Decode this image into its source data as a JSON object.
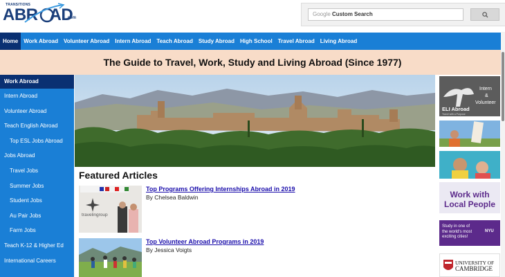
{
  "header": {
    "logo_small": "TRANSITIONS",
    "logo_main": "ABR",
    "logo_main_rest": "AD",
    "logo_com": ".com",
    "search_brand": "Google",
    "search_placeholder": "Custom Search"
  },
  "nav": {
    "items": [
      {
        "label": "Home"
      },
      {
        "label": "Work Abroad"
      },
      {
        "label": "Volunteer Abroad"
      },
      {
        "label": "Intern Abroad"
      },
      {
        "label": "Teach Abroad"
      },
      {
        "label": "Study Abroad"
      },
      {
        "label": "High School"
      },
      {
        "label": "Travel Abroad"
      },
      {
        "label": "Living Abroad"
      }
    ]
  },
  "banner": {
    "title": "The Guide to Travel, Work, Study and Living Abroad (Since 1977)"
  },
  "sidebar": {
    "items": [
      {
        "label": "Work Abroad"
      },
      {
        "label": "Intern Abroad"
      },
      {
        "label": "Volunteer Abroad"
      },
      {
        "label": "Teach English Abroad"
      },
      {
        "label": "Top ESL Jobs Abroad"
      },
      {
        "label": "Jobs Abroad"
      },
      {
        "label": "Travel Jobs"
      },
      {
        "label": "Summer Jobs"
      },
      {
        "label": "Student Jobs"
      },
      {
        "label": "Au Pair Jobs"
      },
      {
        "label": "Farm Jobs"
      },
      {
        "label": "Teach K-12 & Higher Ed"
      },
      {
        "label": "International Careers"
      }
    ]
  },
  "main": {
    "featured_title": "Featured Articles",
    "articles": [
      {
        "title": "Top Programs Offering Internships Abroad in 2019",
        "byline": "By Chelsea Baldwin",
        "thumb_text": "travelingroup"
      },
      {
        "title": "Top Volunteer Abroad Programs in 2019",
        "byline": "By Jessica Voigts"
      }
    ]
  },
  "ads": {
    "eli": {
      "line1": "Intern",
      "line2": "&",
      "line3": "Volunteer",
      "brand": "ELI Abroad",
      "tagline": "Travel with a Purpose"
    },
    "work": {
      "line1": "Work with",
      "line2": "Local People"
    },
    "nyu": {
      "text1": "Study in one of",
      "text2": "the world's most",
      "text3": "exciting cities!",
      "brand": "NYU"
    },
    "cambridge": {
      "line1": "UNIVERSITY OF",
      "line2": "CAMBRIDGE"
    }
  },
  "colors": {
    "nav_blue": "#1a7fd6",
    "nav_active": "#0a3072",
    "banner_bg": "#f8dcc8",
    "link": "#1a0dab"
  }
}
